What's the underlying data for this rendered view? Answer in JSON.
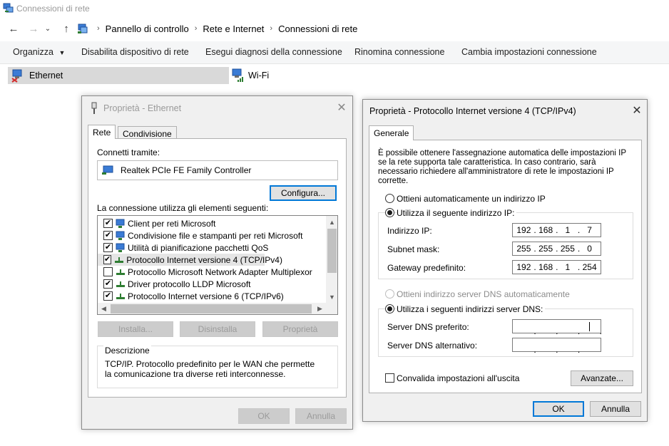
{
  "window": {
    "title": "Connessioni di rete"
  },
  "breadcrumb": [
    "Pannello di controllo",
    "Rete e Internet",
    "Connessioni di rete"
  ],
  "commands": {
    "organize": "Organizza",
    "disable": "Disabilita dispositivo di rete",
    "diagnose": "Esegui diagnosi della connessione",
    "rename": "Rinomina connessione",
    "change": "Cambia impostazioni connessione"
  },
  "adapters": [
    {
      "name": "Ethernet"
    },
    {
      "name": "Wi-Fi"
    }
  ],
  "eth_dialog": {
    "title": "Proprietà - Ethernet",
    "tabs": [
      "Rete",
      "Condivisione"
    ],
    "connect_using_label": "Connetti tramite:",
    "device": "Realtek PCIe FE Family Controller",
    "configure_button": "Configura...",
    "items_label": "La connessione utilizza gli elementi seguenti:",
    "items": [
      {
        "label": "Client per reti Microsoft",
        "checked": "✔"
      },
      {
        "label": "Condivisione file e stampanti per reti Microsoft",
        "checked": "✔"
      },
      {
        "label": "Utilità di pianificazione pacchetti QoS",
        "checked": "✔"
      },
      {
        "label": "Protocollo Internet versione 4 (TCP/IPv4)",
        "checked": "✔"
      },
      {
        "label": "Protocollo Microsoft Network Adapter Multiplexor",
        "checked": ""
      },
      {
        "label": "Driver protocollo LLDP Microsoft",
        "checked": "✔"
      },
      {
        "label": "Protocollo Internet versione 6 (TCP/IPv6)",
        "checked": "✔"
      }
    ],
    "install_button": "Installa...",
    "uninstall_button": "Disinstalla",
    "properties_button": "Proprietà",
    "description_title": "Descrizione",
    "description_text": "TCP/IP. Protocollo predefinito per le WAN che permette la comunicazione tra diverse reti interconnesse.",
    "ok_button": "OK",
    "cancel_button": "Annulla"
  },
  "ipv4_dialog": {
    "title": "Proprietà - Protocollo Internet versione 4 (TCP/IPv4)",
    "tab": "Generale",
    "info": "È possibile ottenere l'assegnazione automatica delle impostazioni IP se la rete supporta tale caratteristica. In caso contrario, sarà necessario richiedere all'amministratore di rete le impostazioni IP corrette.",
    "auto_ip_label": "Ottieni automaticamente un indirizzo IP",
    "manual_ip_label": "Utilizza il seguente indirizzo IP:",
    "ip_label": "Indirizzo IP:",
    "ip_value": [
      "192",
      "168",
      "1",
      "7"
    ],
    "mask_label": "Subnet mask:",
    "mask_value": [
      "255",
      "255",
      "255",
      "0"
    ],
    "gateway_label": "Gateway predefinito:",
    "gateway_value": [
      "192",
      "168",
      "1",
      "254"
    ],
    "auto_dns_label": "Ottieni indirizzo server DNS automaticamente",
    "manual_dns_label": "Utilizza i seguenti indirizzi server DNS:",
    "preferred_dns_label": "Server DNS preferito:",
    "preferred_dns_value": [
      "",
      "",
      "",
      ""
    ],
    "alternate_dns_label": "Server DNS alternativo:",
    "alternate_dns_value": [
      "",
      "",
      "",
      ""
    ],
    "validate_label": "Convalida impostazioni all'uscita",
    "advanced_button": "Avanzate...",
    "ok_button": "OK",
    "cancel_button": "Annulla"
  },
  "colors": {
    "accent": "#0078d7",
    "selection": "#d9d9d9"
  }
}
